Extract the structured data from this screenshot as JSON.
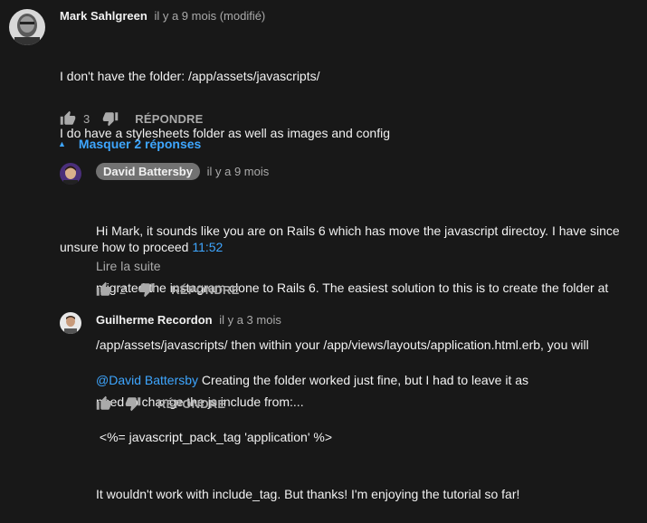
{
  "comments": [
    {
      "author": "Mark Sahlgreen",
      "time": "il y a 9 mois (modifié)",
      "lines": [
        "I don't have the folder: /app/assets/javascripts/",
        "I do have a stylesheets folder as well as images and config",
        "",
        "unsure how to proceed"
      ],
      "timestamp_link": "11:52",
      "likes": "3",
      "reply_label": "RÉPONDRE"
    }
  ],
  "replies_toggle": "Masquer 2 réponses",
  "replies": [
    {
      "author": "David Battersby",
      "time": "il y a 9 mois",
      "lines": [
        "Hi Mark, it sounds like you are on Rails 6 which has move the javascript directoy. I have since",
        "migrated the instagram clone to Rails 6. The easiest solution to this is to create the folder at",
        "/app/assets/javascripts/ then within your /app/views/layouts/application.html.erb, you will",
        "need to change the js include from:..."
      ],
      "read_more": "Lire la suite",
      "likes": "2",
      "reply_label": "RÉPONDRE"
    },
    {
      "author": "Guilherme Recordon",
      "time": "il y a 3 mois",
      "mention": "@David Battersby",
      "lines": [
        " Creating the folder worked just fine, but I had to leave it as",
        " <%= javascript_pack_tag 'application' %>",
        "It wouldn't work with include_tag. But thanks! I'm enjoying the tutorial so far!"
      ],
      "reply_label": "RÉPONDRE"
    }
  ],
  "icons": {
    "like": "thumb-up-icon",
    "dislike": "thumb-down-icon",
    "caret": "caret-up-icon"
  },
  "colors": {
    "background": "#181818",
    "link": "#3ea6ff",
    "muted": "#aaaaaa",
    "badge": "#727272"
  }
}
